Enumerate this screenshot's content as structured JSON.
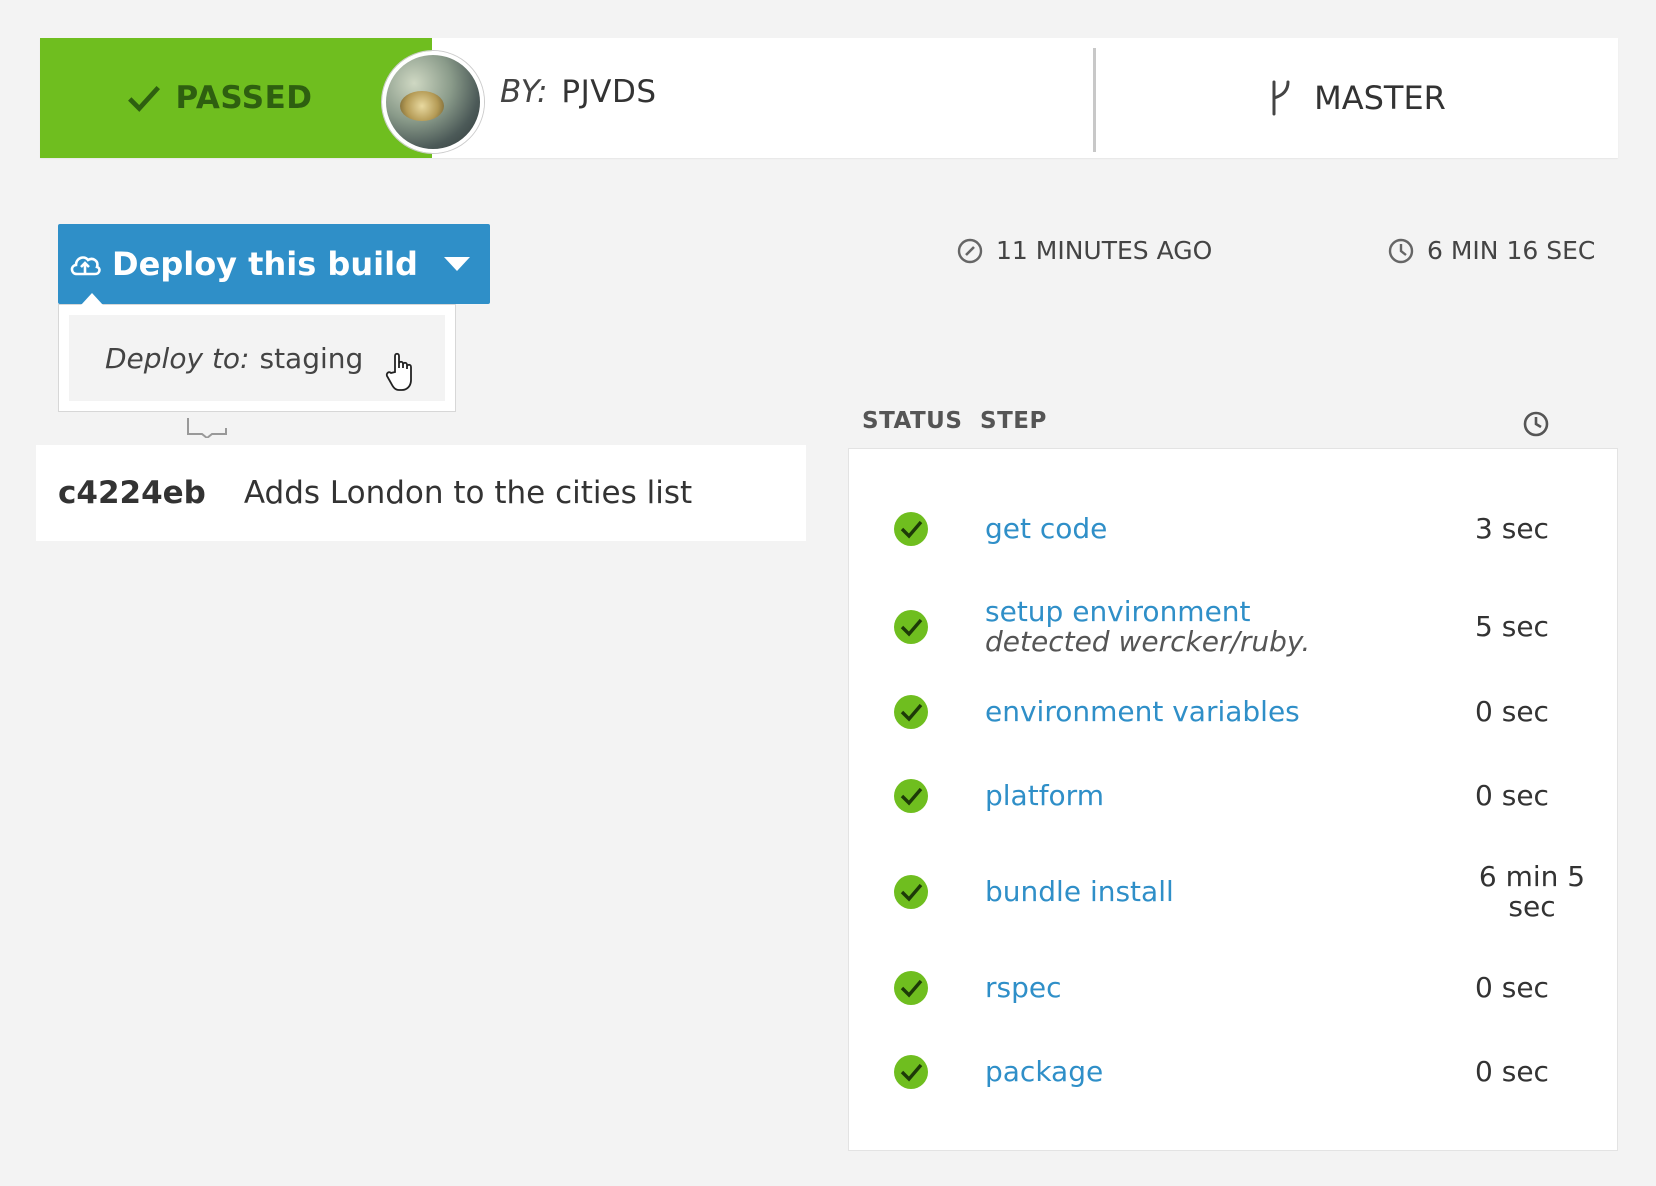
{
  "header": {
    "status": "PASSED",
    "author_prefix": "BY:",
    "author_name": "PJVDS",
    "branch": "MASTER"
  },
  "deploy": {
    "button_label": "Deploy this build",
    "menu_prefix": "Deploy to:",
    "menu_target": "staging"
  },
  "commit": {
    "hash": "c4224eb",
    "message": "Adds London to the cities list"
  },
  "meta": {
    "started_ago": "11 MINUTES AGO",
    "duration": "6 MIN 16 SEC"
  },
  "steps": {
    "header_status": "STATUS",
    "header_step": "STEP",
    "items": [
      {
        "name": "get code",
        "note": "",
        "time": "3 sec",
        "status": "passed"
      },
      {
        "name": "setup environment",
        "note": "detected wercker/ruby.",
        "time": "5 sec",
        "status": "passed"
      },
      {
        "name": "environment variables",
        "note": "",
        "time": "0 sec",
        "status": "passed"
      },
      {
        "name": "platform",
        "note": "",
        "time": "0 sec",
        "status": "passed"
      },
      {
        "name": "bundle install",
        "note": "",
        "time": "6 min 5 sec",
        "status": "passed"
      },
      {
        "name": "rspec",
        "note": "",
        "time": "0 sec",
        "status": "passed"
      },
      {
        "name": "package",
        "note": "",
        "time": "0 sec",
        "status": "passed"
      }
    ]
  },
  "colors": {
    "passed_green": "#6fbe1f",
    "accent_blue": "#2f8fc8",
    "background": "#f3f3f3"
  }
}
